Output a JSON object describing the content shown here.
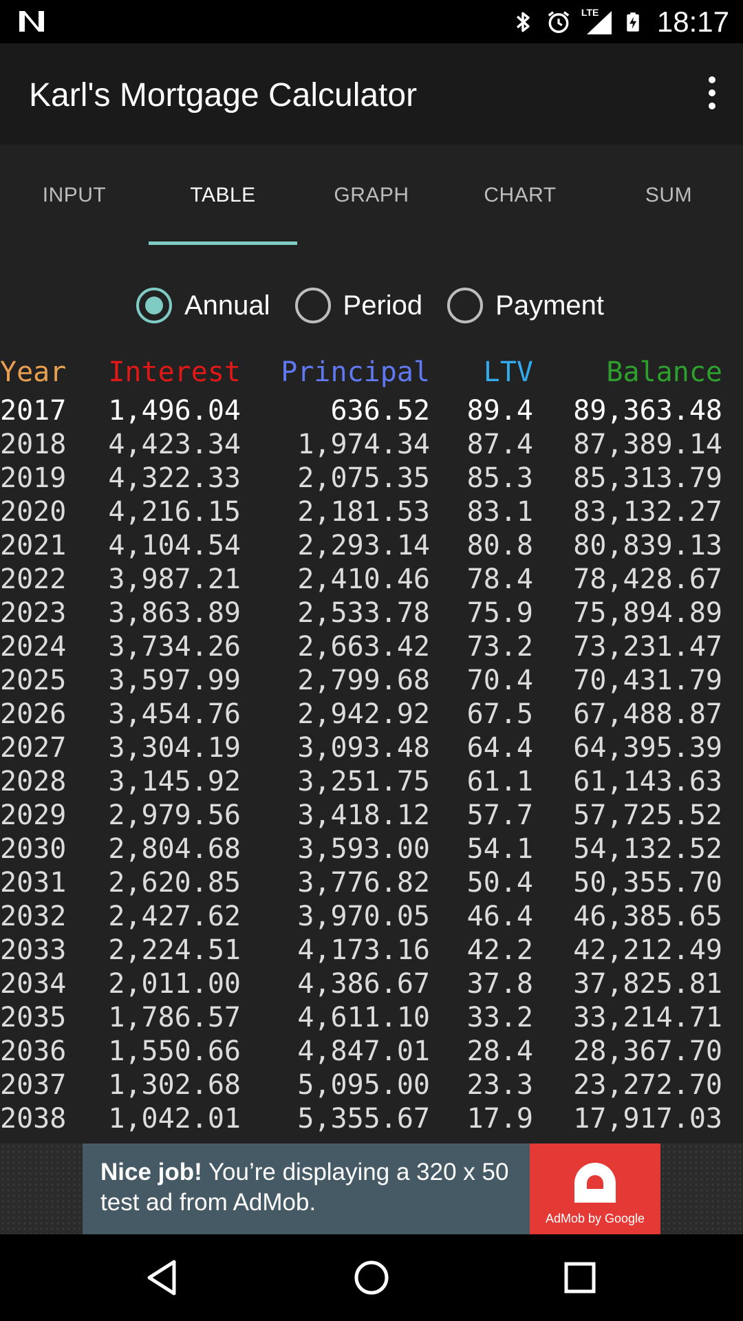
{
  "status_bar": {
    "time": "18:17",
    "lte_label": "LTE",
    "icons": [
      "notification-n-icon",
      "bluetooth-icon",
      "alarm-icon",
      "lte-signal-icon",
      "battery-charging-icon"
    ]
  },
  "app_bar": {
    "title": "Karl's Mortgage Calculator",
    "menu_icon": "overflow-menu-icon"
  },
  "tabs": [
    {
      "label": "INPUT",
      "active": false
    },
    {
      "label": "TABLE",
      "active": true
    },
    {
      "label": "GRAPH",
      "active": false
    },
    {
      "label": "CHART",
      "active": false
    },
    {
      "label": "SUM",
      "active": false
    }
  ],
  "accent_color": "#80cbc4",
  "view_mode": {
    "selected": "Annual",
    "options": [
      "Annual",
      "Period",
      "Payment"
    ]
  },
  "table": {
    "columns": [
      "Year",
      "Interest",
      "Principal",
      "LTV",
      "Balance"
    ],
    "column_colors": [
      "#e8a050",
      "#e01818",
      "#6078f0",
      "#33aaee",
      "#2ea02e"
    ],
    "rows": [
      [
        "2017",
        "1,496.04",
        "636.52",
        "89.4",
        "89,363.48"
      ],
      [
        "2018",
        "4,423.34",
        "1,974.34",
        "87.4",
        "87,389.14"
      ],
      [
        "2019",
        "4,322.33",
        "2,075.35",
        "85.3",
        "85,313.79"
      ],
      [
        "2020",
        "4,216.15",
        "2,181.53",
        "83.1",
        "83,132.27"
      ],
      [
        "2021",
        "4,104.54",
        "2,293.14",
        "80.8",
        "80,839.13"
      ],
      [
        "2022",
        "3,987.21",
        "2,410.46",
        "78.4",
        "78,428.67"
      ],
      [
        "2023",
        "3,863.89",
        "2,533.78",
        "75.9",
        "75,894.89"
      ],
      [
        "2024",
        "3,734.26",
        "2,663.42",
        "73.2",
        "73,231.47"
      ],
      [
        "2025",
        "3,597.99",
        "2,799.68",
        "70.4",
        "70,431.79"
      ],
      [
        "2026",
        "3,454.76",
        "2,942.92",
        "67.5",
        "67,488.87"
      ],
      [
        "2027",
        "3,304.19",
        "3,093.48",
        "64.4",
        "64,395.39"
      ],
      [
        "2028",
        "3,145.92",
        "3,251.75",
        "61.1",
        "61,143.63"
      ],
      [
        "2029",
        "2,979.56",
        "3,418.12",
        "57.7",
        "57,725.52"
      ],
      [
        "2030",
        "2,804.68",
        "3,593.00",
        "54.1",
        "54,132.52"
      ],
      [
        "2031",
        "2,620.85",
        "3,776.82",
        "50.4",
        "50,355.70"
      ],
      [
        "2032",
        "2,427.62",
        "3,970.05",
        "46.4",
        "46,385.65"
      ],
      [
        "2033",
        "2,224.51",
        "4,173.16",
        "42.2",
        "42,212.49"
      ],
      [
        "2034",
        "2,011.00",
        "4,386.67",
        "37.8",
        "37,825.81"
      ],
      [
        "2035",
        "1,786.57",
        "4,611.10",
        "33.2",
        "33,214.71"
      ],
      [
        "2036",
        "1,550.66",
        "4,847.01",
        "28.4",
        "28,367.70"
      ],
      [
        "2037",
        "1,302.68",
        "5,095.00",
        "23.3",
        "23,272.70"
      ],
      [
        "2038",
        "1,042.01",
        "5,355.67",
        "17.9",
        "17,917.03"
      ]
    ]
  },
  "ad": {
    "headline": "Nice job!",
    "body": " You’re displaying a 320 x 50 test ad from AdMob.",
    "brand": "AdMob by Google"
  },
  "nav_bar": {
    "icons": [
      "back-icon",
      "home-icon",
      "recents-icon"
    ]
  }
}
